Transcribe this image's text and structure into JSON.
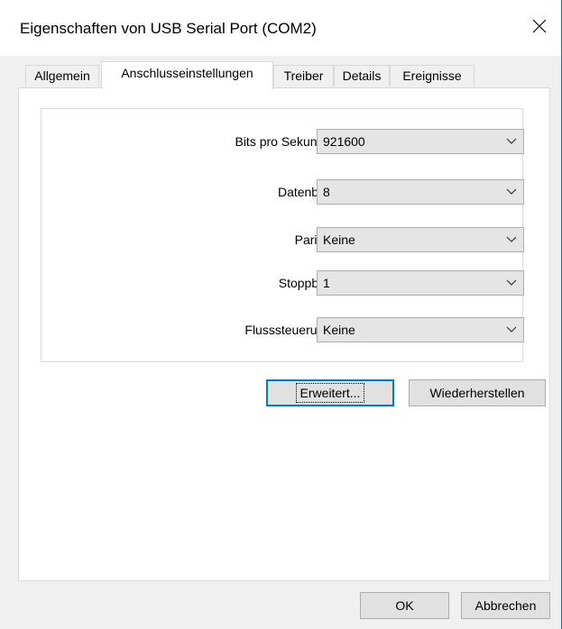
{
  "window": {
    "title": "Eigenschaften von USB Serial Port (COM2)"
  },
  "tabs": [
    {
      "label": "Allgemein",
      "active": false
    },
    {
      "label": "Anschlusseinstellungen",
      "active": true
    },
    {
      "label": "Treiber",
      "active": false
    },
    {
      "label": "Details",
      "active": false
    },
    {
      "label": "Ereignisse",
      "active": false
    }
  ],
  "settings": {
    "baud": {
      "label": "Bits pro Sekunde:",
      "value": "921600"
    },
    "databits": {
      "label": "Datenbits:",
      "value": "8"
    },
    "parity": {
      "label": "Parität:",
      "value": "Keine"
    },
    "stopbits": {
      "label": "Stoppbits:",
      "value": "1"
    },
    "flow": {
      "label": "Flusssteuerung:",
      "value": "Keine"
    }
  },
  "buttons": {
    "advanced": "Erweitert...",
    "restore": "Wiederherstellen",
    "ok": "OK",
    "cancel": "Abbrechen"
  },
  "colors": {
    "accent": "#0078d7",
    "window_border": "#1e6fcb"
  },
  "icons": {
    "close": "close-icon",
    "dropdown": "chevron-down-icon"
  }
}
